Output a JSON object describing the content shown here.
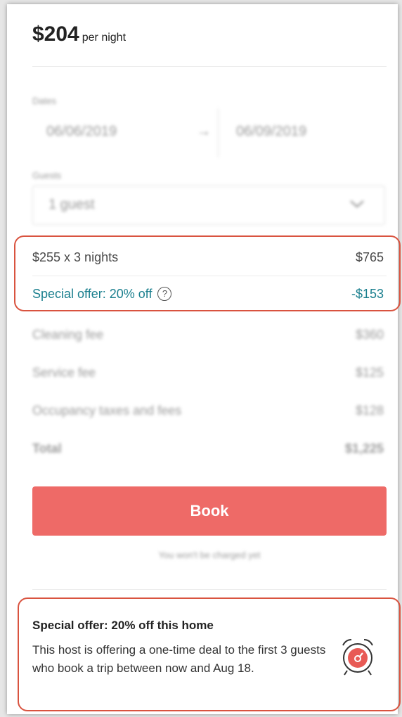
{
  "header": {
    "price": "$204",
    "price_unit": "per night"
  },
  "dates": {
    "label": "Dates",
    "check_in": "06/06/2019",
    "arrow": "→",
    "check_out": "06/09/2019"
  },
  "guests": {
    "label": "Guests",
    "value": "1 guest"
  },
  "breakdown": {
    "nightly": {
      "label": "$255 x 3 nights",
      "amount": "$765"
    },
    "special_offer": {
      "label": "Special offer: 20% off",
      "amount": "-$153"
    },
    "cleaning": {
      "label": "Cleaning fee",
      "amount": "$360"
    },
    "service": {
      "label": "Service fee",
      "amount": "$125"
    },
    "occupancy": {
      "label": "Occupancy taxes and fees",
      "amount": "$128"
    },
    "total": {
      "label": "Total",
      "amount": "$1,225"
    }
  },
  "book": {
    "label": "Book",
    "note": "You won't be charged yet"
  },
  "offer_card": {
    "title": "Special offer: 20% off this home",
    "body": "This host is offering a one-time deal to the first 3 guests who book a trip between now and Aug 18."
  },
  "colors": {
    "accent": "#ee6a67",
    "teal": "#1a7f8e",
    "highlight": "#d9533f"
  }
}
